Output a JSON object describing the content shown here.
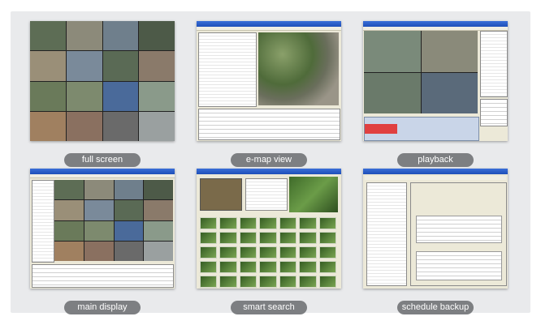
{
  "tiles": [
    {
      "caption": "full screen"
    },
    {
      "caption": "e-map view"
    },
    {
      "caption": "playback"
    },
    {
      "caption": "main display"
    },
    {
      "caption": "smart search"
    },
    {
      "caption": "schedule backup"
    }
  ],
  "colors": {
    "background": "#e9eaec",
    "pill": "#7d7f82",
    "pill_text": "#ffffff"
  }
}
